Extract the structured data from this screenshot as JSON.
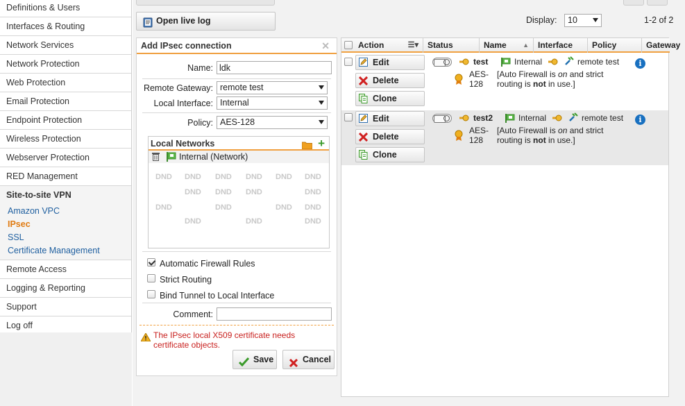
{
  "sidebar": {
    "items_top": [
      "Definitions & Users",
      "Interfaces & Routing",
      "Network Services",
      "Network Protection",
      "Web Protection",
      "Email Protection",
      "Endpoint Protection",
      "Wireless Protection",
      "Webserver Protection",
      "RED Management"
    ],
    "group": {
      "title": "Site-to-site VPN",
      "subitems": [
        "Amazon VPC",
        "IPsec",
        "SSL",
        "Certificate Management"
      ],
      "active": "IPsec"
    },
    "items_bottom": [
      "Remote Access",
      "Logging & Reporting",
      "Support",
      "Log off"
    ]
  },
  "toolbar": {
    "open_live_log": "Open live log",
    "display_label": "Display:",
    "display_value": "10",
    "page_range": "1-2 of 2"
  },
  "form": {
    "title": "Add IPsec connection",
    "name_label": "Name:",
    "name_value": "ldk",
    "remote_gateway_label": "Remote Gateway:",
    "remote_gateway_value": "remote test",
    "local_interface_label": "Local Interface:",
    "local_interface_value": "Internal",
    "policy_label": "Policy:",
    "policy_value": "AES-128",
    "local_networks": {
      "title": "Local Networks",
      "items": [
        "Internal (Network)"
      ],
      "dnd": "DND"
    },
    "automatic_firewall_rules": "Automatic Firewall Rules",
    "strict_routing": "Strict Routing",
    "bind_tunnel": "Bind Tunnel to Local Interface",
    "comment_label": "Comment:",
    "comment_value": "",
    "warning": "The IPsec local X509 certificate needs certificate objects.",
    "save": "Save",
    "cancel": "Cancel"
  },
  "table": {
    "columns": [
      "Action",
      "Status",
      "Name",
      "Interface",
      "Policy",
      "Gateway"
    ],
    "actions": {
      "edit": "Edit",
      "delete": "Delete",
      "clone": "Clone"
    },
    "rows": [
      {
        "name": "test",
        "interface": "Internal",
        "gateway": "remote test",
        "policy_line1": "AES-",
        "policy_line2": "128",
        "note1_a": "[Auto Firewall is ",
        "note1_b": "on",
        "note1_c": " and strict",
        "note2_a": "routing is ",
        "note2_b": "not",
        "note2_c": " in use.]"
      },
      {
        "name": "test2",
        "interface": "Internal",
        "gateway": "remote test",
        "policy_line1": "AES-",
        "policy_line2": "128",
        "note1_a": "[Auto Firewall is ",
        "note1_b": "on",
        "note1_c": " and strict",
        "note2_a": "routing is ",
        "note2_b": "not",
        "note2_c": " in use.]"
      }
    ]
  },
  "colors": {
    "accent": "#f0a040",
    "warning": "#c8201e",
    "link": "#2060a0",
    "active": "#e07b12",
    "info": "#1870c0"
  }
}
